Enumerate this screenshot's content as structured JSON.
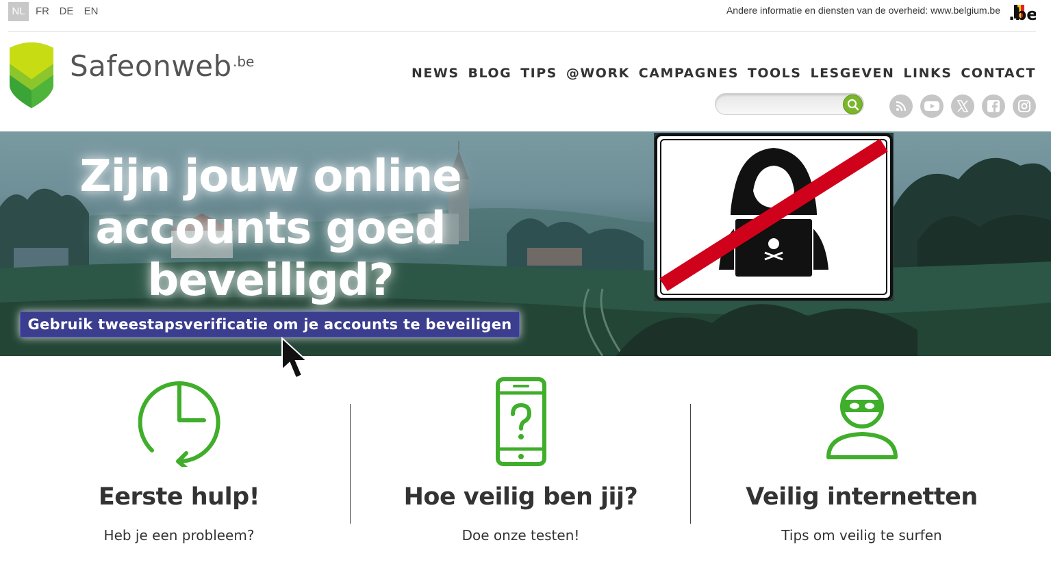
{
  "topbar": {
    "languages": [
      {
        "code": "NL",
        "active": true
      },
      {
        "code": "FR",
        "active": false
      },
      {
        "code": "DE",
        "active": false
      },
      {
        "code": "EN",
        "active": false
      }
    ],
    "gov_text": "Andere informatie en diensten van de overheid: ",
    "gov_link": "www.belgium.be",
    "be_logo": ".be"
  },
  "brand": {
    "name": "Safeonweb",
    "suffix": ".be"
  },
  "nav": [
    "NEWS",
    "BLOG",
    "TIPS",
    "@WORK",
    "CAMPAGNES",
    "TOOLS",
    "LESGEVEN",
    "LINKS",
    "CONTACT"
  ],
  "search": {
    "placeholder": "",
    "value": ""
  },
  "social": [
    "rss-icon",
    "youtube-icon",
    "x-icon",
    "facebook-icon",
    "instagram-icon"
  ],
  "hero": {
    "title_line1": "Zijn jouw online",
    "title_line2": "accounts goed",
    "title_line3": "beveiligd?",
    "cta": "Gebruik tweestapsverificatie om je accounts te beveiligen"
  },
  "features": [
    {
      "icon": "clock-icon",
      "title": "Eerste hulp!",
      "subtitle": "Heb je een probleem?"
    },
    {
      "icon": "phone-question-icon",
      "title": "Hoe veilig ben jij?",
      "subtitle": "Doe onze testen!"
    },
    {
      "icon": "masked-person-icon",
      "title": "Veilig internetten",
      "subtitle": "Tips om veilig te surfen"
    }
  ],
  "colors": {
    "brand_green": "#4caf2e",
    "icon_green": "#3fae2a",
    "cta_blue": "#3b3d8f",
    "sign_red": "#d0021b"
  }
}
